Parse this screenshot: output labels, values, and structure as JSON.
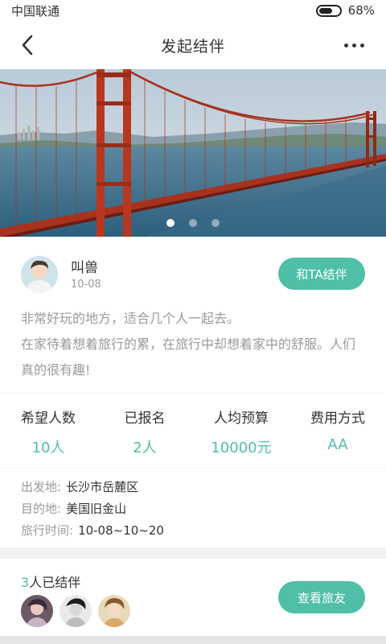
{
  "status_bar": {
    "carrier": "中国联通",
    "battery": "68%",
    "battery_level": 0.68
  },
  "nav": {
    "title": "发起结伴",
    "back_icon": "chevron-left-icon",
    "more_icon": "more-dots-icon"
  },
  "banner": {
    "slide_count": 3,
    "active_index": 0
  },
  "organizer": {
    "name": "叫兽",
    "date": "10-08",
    "join_label": "和TA结伴",
    "description": [
      "非常好玩的地方，适合几个人一起去。",
      "在家待着想着旅行的累，在旅行中却想着家中的舒服。人们真的很有趣!"
    ]
  },
  "stats": [
    {
      "label": "希望人数",
      "value": "10人"
    },
    {
      "label": "已报名",
      "value": "2人"
    },
    {
      "label": "人均预算",
      "value": "10000元"
    },
    {
      "label": "费用方式",
      "value": "AA"
    }
  ],
  "trip_info": {
    "departure_label": "出发地:",
    "departure": "长沙市岳麓区",
    "destination_label": "目的地:",
    "destination": "美国旧金山",
    "time_label": "旅行时间:",
    "time": "10-08~10~20"
  },
  "partners": {
    "count": "3",
    "suffix": "人已结伴",
    "view_label": "查看旅友"
  },
  "colors": {
    "accent": "#4fbfa8",
    "muted": "#9a9a9a",
    "text": "#333333",
    "divider": "#f2f2f2"
  }
}
